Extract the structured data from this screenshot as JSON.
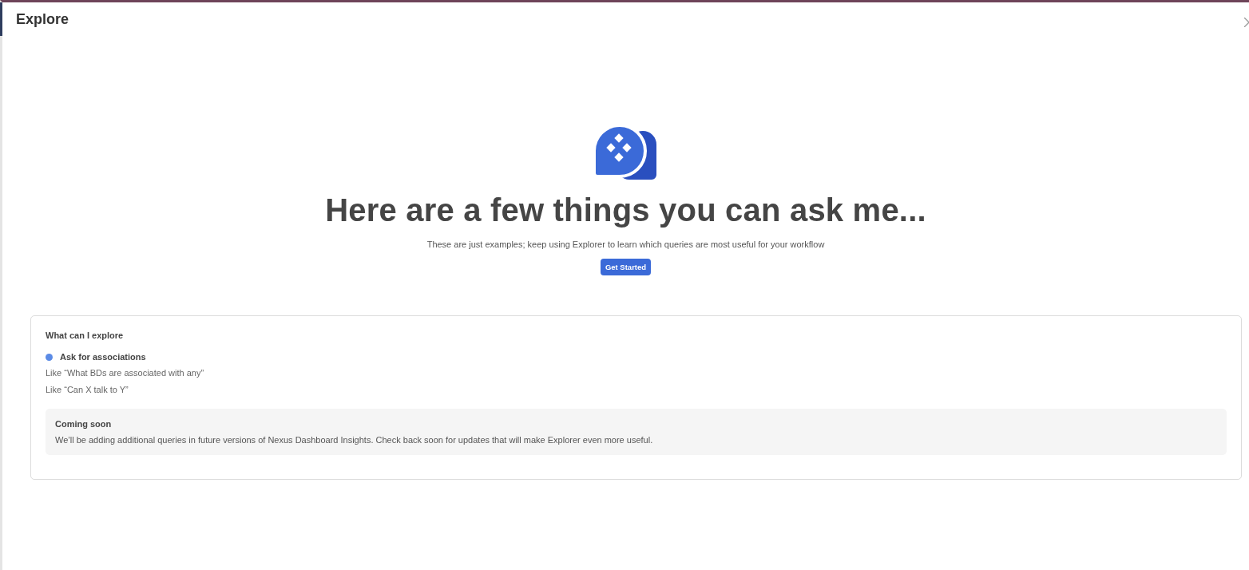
{
  "window": {
    "title": "Explore"
  },
  "hero": {
    "heading": "Here are a few things you can ask me...",
    "subtitle": "These are just examples; keep using Explorer to learn which queries are most useful for your workflow",
    "button": "Get Started"
  },
  "explore_card": {
    "title": "What can I explore",
    "topics": [
      {
        "label": "Ask for associations",
        "examples": [
          "Like “What BDs are associated with any”",
          "Like “Can X talk to Y”"
        ]
      }
    ],
    "notice": {
      "title": "Coming soon",
      "text": "We’ll be adding additional queries in future versions of Nexus Dashboard Insights. Check back soon for updates that will make Explorer even more useful."
    }
  }
}
